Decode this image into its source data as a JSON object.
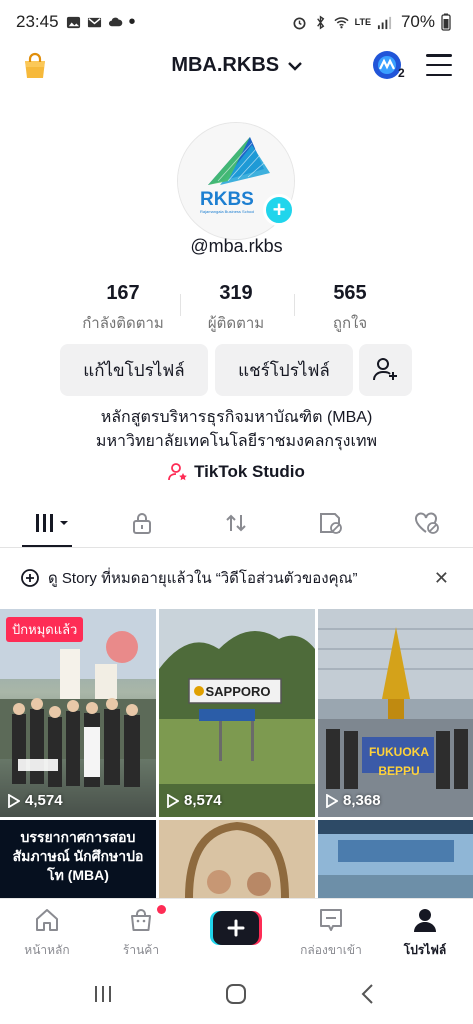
{
  "status_bar": {
    "time": "23:45",
    "battery": "70%",
    "network": "LTE"
  },
  "header": {
    "account_name": "MBA.RKBS",
    "creator_badge": "2"
  },
  "profile": {
    "avatar_text": "RKBS",
    "avatar_subtext": "Rajamangala Business School",
    "handle": "@mba.rkbs",
    "stats": [
      {
        "value": "167",
        "label": "กำลังติดตาม"
      },
      {
        "value": "319",
        "label": "ผู้ติดตาม"
      },
      {
        "value": "565",
        "label": "ถูกใจ"
      }
    ],
    "edit_button": "แก้ไขโปรไฟล์",
    "share_button": "แชร์โปรไฟล์",
    "bio_line1": "หลักสูตรบริหารธุรกิจมหาบัณฑิต (MBA)",
    "bio_line2": "มหาวิทยาลัยเทคโนโลยีราชมงคลกรุงเทพ",
    "studio_label": "TikTok Studio"
  },
  "story_banner": {
    "prefix": "ดู Story",
    "text": "ที่หมดอายุแล้วใน “วิดีโอส่วนตัวของคุณ”"
  },
  "videos": [
    {
      "views": "4,574",
      "pinned": "ปักหมุดแล้ว",
      "overlay": ""
    },
    {
      "views": "8,574",
      "pinned": "",
      "overlay": "SAPPORO"
    },
    {
      "views": "8,368",
      "pinned": "",
      "overlay": "FUKUOKA BEPPU"
    },
    {
      "views": "",
      "pinned": "",
      "overlay": "บรรยากาศการสอบสัมภาษณ์ นักศึกษาปอโท (MBA)"
    },
    {
      "views": "",
      "pinned": "",
      "overlay": ""
    },
    {
      "views": "",
      "pinned": "",
      "overlay": ""
    }
  ],
  "bottom_nav": {
    "home": "หน้าหลัก",
    "shop": "ร้านค้า",
    "inbox": "กล่องขาเข้า",
    "profile": "โปรไฟล์"
  },
  "colors": {
    "accent": "#fe2c55",
    "cyan": "#20d5ec",
    "text": "#161823",
    "muted": "#737373"
  }
}
